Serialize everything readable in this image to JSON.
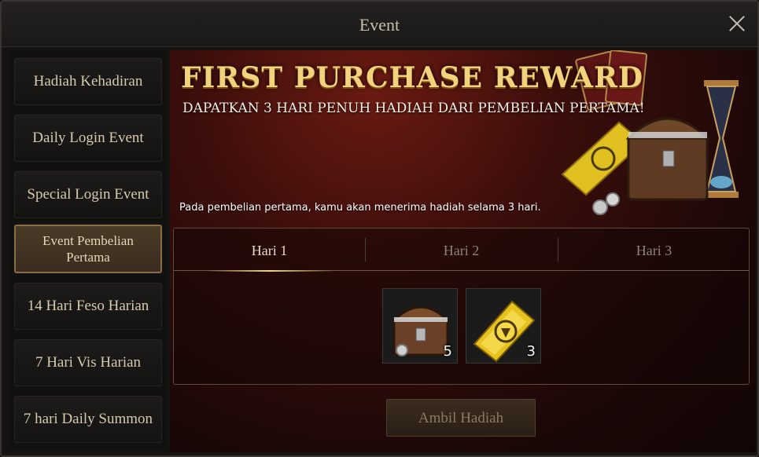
{
  "window": {
    "title": "Event"
  },
  "sidebar": {
    "items": [
      {
        "label": "Hadiah Kehadiran",
        "active": false
      },
      {
        "label": "Daily Login Event",
        "active": false
      },
      {
        "label": "Special Login Event",
        "active": false
      },
      {
        "label": "Event Pembelian Pertama",
        "active": true
      },
      {
        "label": "14 Hari Feso Harian",
        "active": false
      },
      {
        "label": "7 Hari Vis Harian",
        "active": false
      },
      {
        "label": "7 hari Daily Summon",
        "active": false
      }
    ]
  },
  "banner": {
    "title": "FIRST PURCHASE REWARD",
    "subtitle": "DAPATKAN 3 HARI PENUH HADIAH DARI PEMBELIAN PERTAMA!",
    "description": "Pada pembelian pertama, kamu akan menerima hadiah selama 3 hari."
  },
  "days": {
    "tabs": [
      {
        "label": "Hari 1",
        "active": true
      },
      {
        "label": "Hari 2",
        "active": false
      },
      {
        "label": "Hari 3",
        "active": false
      }
    ],
    "rewards": [
      {
        "icon": "treasure-chest-icon",
        "count": "5"
      },
      {
        "icon": "gold-ticket-icon",
        "count": "3"
      }
    ]
  },
  "claim_button": {
    "label": "Ambil Hadiah"
  },
  "colors": {
    "accent_gold": "#f2d27a",
    "active_border": "#8a6d46"
  }
}
